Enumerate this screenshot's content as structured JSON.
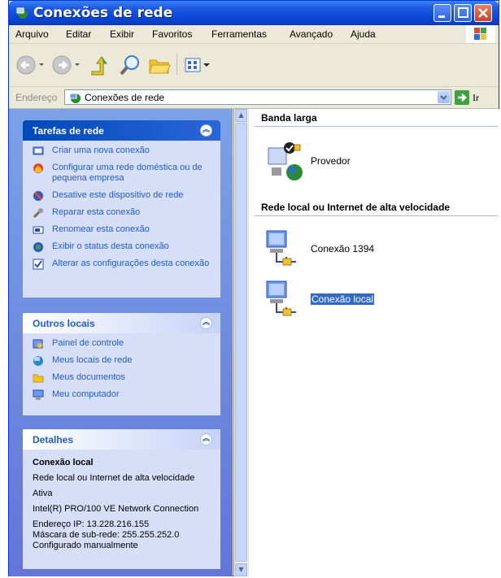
{
  "window": {
    "title": "Conexões de rede"
  },
  "menu": [
    "Arquivo",
    "Editar",
    "Exibir",
    "Favoritos",
    "Ferramentas",
    "Avançado",
    "Ajuda"
  ],
  "address": {
    "label": "Endereço",
    "value": "Conexões de rede",
    "go_label": "Ir"
  },
  "tasks_panel": {
    "title": "Tarefas de rede",
    "items": [
      "Criar uma nova conexão",
      "Configurar uma rede doméstica ou de pequena empresa",
      "Desative este dispositivo de rede",
      "Reparar esta conexão",
      "Renomear esta conexão",
      "Exibir o status desta conexão",
      "Alterar as configurações desta conexão"
    ]
  },
  "places_panel": {
    "title": "Outros locais",
    "items": [
      "Painel de controle",
      "Meus locais de rede",
      "Meus documentos",
      "Meu computador"
    ]
  },
  "details_panel": {
    "title": "Detalhes",
    "name": "Conexão local",
    "type": "Rede local ou Internet de alta velocidade",
    "status": "Ativa",
    "adapter": "Intel(R) PRO/100 VE Network Connection",
    "ip": "Endereço IP: 13.228.216.155",
    "mask": "Máscara de sub-rede: 255.255.252.0",
    "config": "Configurado manualmente"
  },
  "groups": {
    "broadband": {
      "title": "Banda larga",
      "items": [
        "Provedor"
      ]
    },
    "lan": {
      "title": "Rede local ou Internet de alta velocidade",
      "items": [
        "Conexão 1394",
        "Conexão local"
      ]
    }
  },
  "colors": {
    "title_bar": "#0a46d8",
    "task_link": "#215dc6",
    "selection": "#316ac5"
  }
}
